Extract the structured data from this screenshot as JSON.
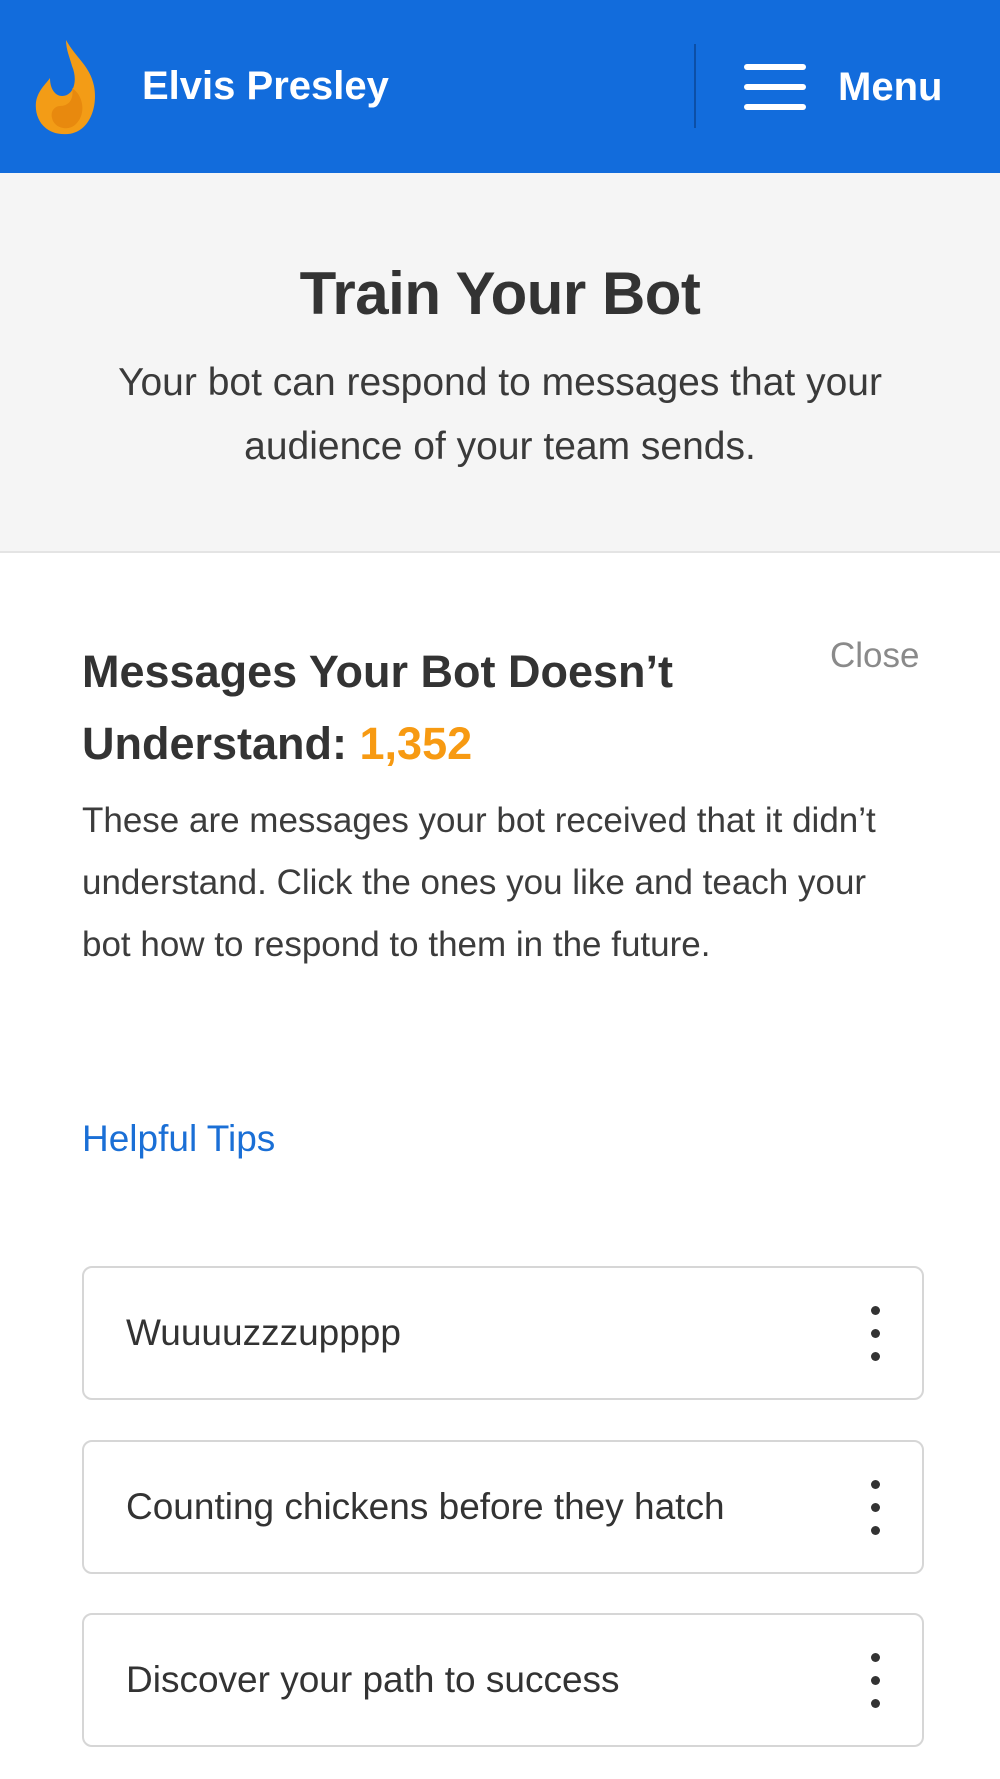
{
  "header": {
    "brand_name": "Elvis Presley",
    "menu_label": "Menu",
    "accent_color": "#126cdc"
  },
  "hero": {
    "title": "Train Your Bot",
    "subtitle": "Your bot can respond to messages that your audience of your team sends."
  },
  "card": {
    "title": "Messages Your Bot Doesn’t Understand:",
    "count": "1,352",
    "count_color": "#f79a12",
    "close_label": "Close",
    "description": "These are messages your bot received that it didn’t understand. Click the ones you like and teach your bot how to respond to them in the future.",
    "tips_label": "Helpful Tips"
  },
  "messages": [
    {
      "text": "Wuuuuzzzupppp"
    },
    {
      "text": "Counting chickens before they hatch"
    },
    {
      "text": "Discover your path to success"
    }
  ]
}
